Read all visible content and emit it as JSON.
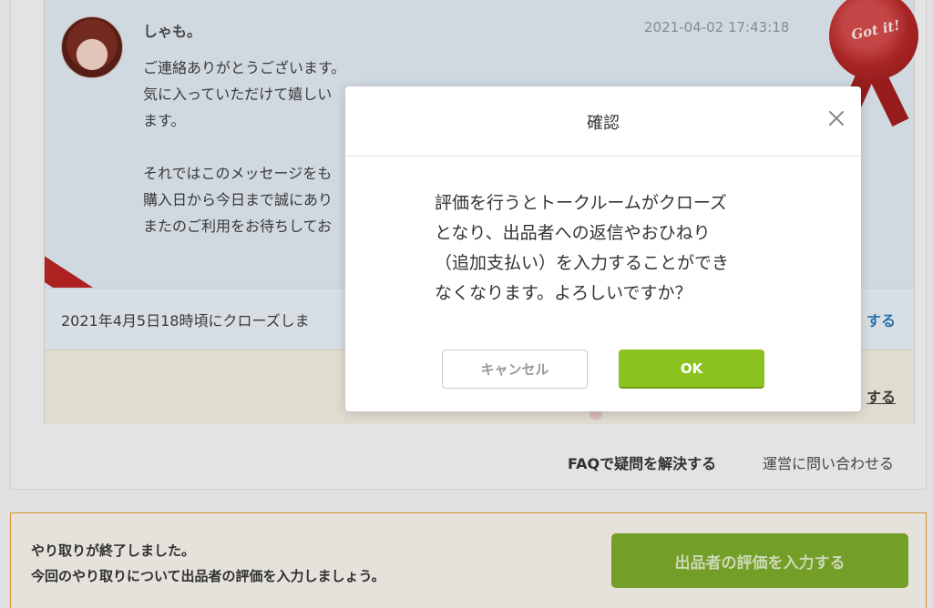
{
  "message": {
    "sender": "しゃも。",
    "date": "2021-04-02 17:43:18",
    "lines": [
      "ご連絡ありがとうございます。",
      "気に入っていただけて嬉しい",
      "ます。",
      "",
      "それではこのメッセージをも",
      "購入日から今日まで誠にあり",
      "またのご利用をお待ちしてお"
    ],
    "seal_text": "Got it!"
  },
  "close_notice": {
    "text": "2021年4月5日18時頃にクローズしま",
    "link": "する"
  },
  "review_row": {
    "link": "する"
  },
  "footer_links": {
    "faq": "FAQで疑問を解決する",
    "contact": "運営に問い合わせる"
  },
  "end_box": {
    "line1": "やり取りが終了しました。",
    "line2": "今回のやり取りについて出品者の評価を入力しましょう。",
    "button": "出品者の評価を入力する"
  },
  "dialog": {
    "title": "確認",
    "message_lines": [
      "評価を行うとトークルームがクローズ",
      "となり、出品者への返信やおひねり",
      "（追加支払い）を入力することができ",
      "なくなります。よろしいですか？"
    ],
    "cancel_label": "キャンセル",
    "ok_label": "OK"
  },
  "colors": {
    "ok_green": "#8cc21f",
    "rate_button_green": "#7ba82a",
    "end_box_border": "#e29d31",
    "link_blue": "#2a7ab8",
    "seal_red": "#b32727"
  },
  "icons": {
    "close": "close-icon"
  }
}
